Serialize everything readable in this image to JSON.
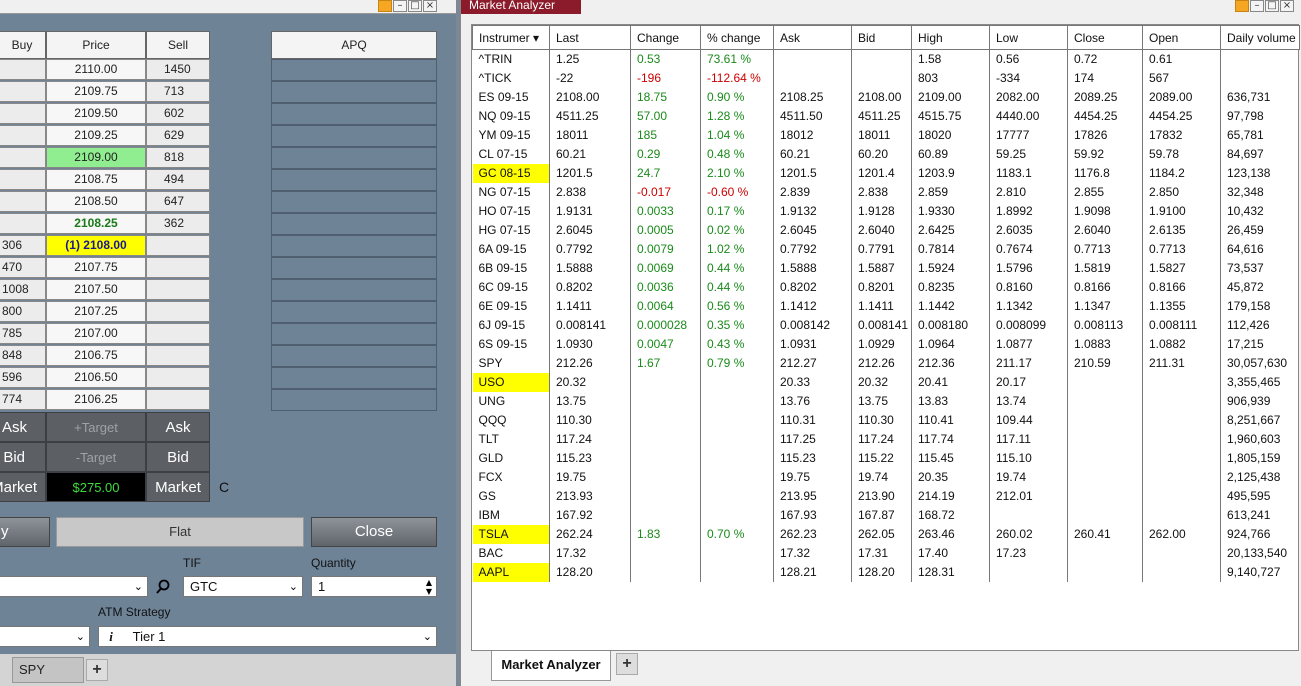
{
  "left_panel": {
    "headers": {
      "buy": "Buy",
      "price": "Price",
      "sell": "Sell",
      "apq": "APQ"
    },
    "ladder": [
      {
        "buy": "",
        "price": "2110.00",
        "sell": "1450"
      },
      {
        "buy": "",
        "price": "2109.75",
        "sell": "713"
      },
      {
        "buy": "",
        "price": "2109.50",
        "sell": "602"
      },
      {
        "buy": "",
        "price": "2109.25",
        "sell": "629"
      },
      {
        "buy": "",
        "price": "2109.00",
        "sell": "818"
      },
      {
        "buy": "",
        "price": "2108.75",
        "sell": "494"
      },
      {
        "buy": "",
        "price": "2108.50",
        "sell": "647"
      },
      {
        "buy": "",
        "price": "2108.25",
        "sell": "362"
      },
      {
        "buy": "306",
        "price": "(1) 2108.00",
        "sell": ""
      },
      {
        "buy": "470",
        "price": "2107.75",
        "sell": ""
      },
      {
        "buy": "1008",
        "price": "2107.50",
        "sell": ""
      },
      {
        "buy": "800",
        "price": "2107.25",
        "sell": ""
      },
      {
        "buy": "785",
        "price": "2107.00",
        "sell": ""
      },
      {
        "buy": "848",
        "price": "2106.75",
        "sell": ""
      },
      {
        "buy": "596",
        "price": "2106.50",
        "sell": ""
      },
      {
        "buy": "774",
        "price": "2106.25",
        "sell": ""
      }
    ],
    "buttons": {
      "buy_ask": "Ask",
      "target": "+Target",
      "sell_ask": "Ask",
      "buy_bid": "Bid",
      "stop": "-Target",
      "sell_bid": "Bid",
      "buy_market": "Market",
      "pnl": "$275.00",
      "sell_market": "Market",
      "c_label": "C",
      "rev": "y",
      "flat": "Flat",
      "close": "Close"
    },
    "order_fields": {
      "tif_label": "TIF",
      "tif_value": "GTC",
      "quantity_label": "Quantity",
      "quantity_value": "1",
      "atm_label": "ATM Strategy",
      "atm_value": "Tier 1"
    },
    "bottom_tab": "SPY"
  },
  "market_analyzer": {
    "window_title": "Market Analyzer",
    "tab_label": "Market Analyzer",
    "columns": [
      "Instrumer ▾",
      "Last",
      "Change",
      "% change",
      "Ask",
      "Bid",
      "High",
      "Low",
      "Close",
      "Open",
      "Daily volume"
    ],
    "rows": [
      {
        "inst": "^TRIN",
        "last": "1.25",
        "chg": "0.53",
        "pct": "73.61 %",
        "ask": "",
        "bid": "",
        "high": "1.58",
        "low": "0.56",
        "close": "0.72",
        "open": "0.61",
        "vol": "",
        "hl": false,
        "dir": "pos"
      },
      {
        "inst": "^TICK",
        "last": "-22",
        "chg": "-196",
        "pct": "-112.64 %",
        "ask": "",
        "bid": "",
        "high": "803",
        "low": "-334",
        "close": "174",
        "open": "567",
        "vol": "",
        "hl": false,
        "dir": "neg"
      },
      {
        "inst": "ES 09-15",
        "last": "2108.00",
        "chg": "18.75",
        "pct": "0.90 %",
        "ask": "2108.25",
        "bid": "2108.00",
        "high": "2109.00",
        "low": "2082.00",
        "close": "2089.25",
        "open": "2089.00",
        "vol": "636,731",
        "hl": false,
        "dir": "pos"
      },
      {
        "inst": "NQ 09-15",
        "last": "4511.25",
        "chg": "57.00",
        "pct": "1.28 %",
        "ask": "4511.50",
        "bid": "4511.25",
        "high": "4515.75",
        "low": "4440.00",
        "close": "4454.25",
        "open": "4454.25",
        "vol": "97,798",
        "hl": false,
        "dir": "pos"
      },
      {
        "inst": "YM 09-15",
        "last": "18011",
        "chg": "185",
        "pct": "1.04 %",
        "ask": "18012",
        "bid": "18011",
        "high": "18020",
        "low": "17777",
        "close": "17826",
        "open": "17832",
        "vol": "65,781",
        "hl": false,
        "dir": "pos"
      },
      {
        "inst": "CL 07-15",
        "last": "60.21",
        "chg": "0.29",
        "pct": "0.48 %",
        "ask": "60.21",
        "bid": "60.20",
        "high": "60.89",
        "low": "59.25",
        "close": "59.92",
        "open": "59.78",
        "vol": "84,697",
        "hl": false,
        "dir": "pos"
      },
      {
        "inst": "GC 08-15",
        "last": "1201.5",
        "chg": "24.7",
        "pct": "2.10 %",
        "ask": "1201.5",
        "bid": "1201.4",
        "high": "1203.9",
        "low": "1183.1",
        "close": "1176.8",
        "open": "1184.2",
        "vol": "123,138",
        "hl": true,
        "dir": "pos"
      },
      {
        "inst": "NG 07-15",
        "last": "2.838",
        "chg": "-0.017",
        "pct": "-0.60 %",
        "ask": "2.839",
        "bid": "2.838",
        "high": "2.859",
        "low": "2.810",
        "close": "2.855",
        "open": "2.850",
        "vol": "32,348",
        "hl": false,
        "dir": "neg"
      },
      {
        "inst": "HO 07-15",
        "last": "1.9131",
        "chg": "0.0033",
        "pct": "0.17 %",
        "ask": "1.9132",
        "bid": "1.9128",
        "high": "1.9330",
        "low": "1.8992",
        "close": "1.9098",
        "open": "1.9100",
        "vol": "10,432",
        "hl": false,
        "dir": "pos"
      },
      {
        "inst": "HG 07-15",
        "last": "2.6045",
        "chg": "0.0005",
        "pct": "0.02 %",
        "ask": "2.6045",
        "bid": "2.6040",
        "high": "2.6425",
        "low": "2.6035",
        "close": "2.6040",
        "open": "2.6135",
        "vol": "26,459",
        "hl": false,
        "dir": "pos"
      },
      {
        "inst": "6A 09-15",
        "last": "0.7792",
        "chg": "0.0079",
        "pct": "1.02 %",
        "ask": "0.7792",
        "bid": "0.7791",
        "high": "0.7814",
        "low": "0.7674",
        "close": "0.7713",
        "open": "0.7713",
        "vol": "64,616",
        "hl": false,
        "dir": "pos"
      },
      {
        "inst": "6B 09-15",
        "last": "1.5888",
        "chg": "0.0069",
        "pct": "0.44 %",
        "ask": "1.5888",
        "bid": "1.5887",
        "high": "1.5924",
        "low": "1.5796",
        "close": "1.5819",
        "open": "1.5827",
        "vol": "73,537",
        "hl": false,
        "dir": "pos"
      },
      {
        "inst": "6C 09-15",
        "last": "0.8202",
        "chg": "0.0036",
        "pct": "0.44 %",
        "ask": "0.8202",
        "bid": "0.8201",
        "high": "0.8235",
        "low": "0.8160",
        "close": "0.8166",
        "open": "0.8166",
        "vol": "45,872",
        "hl": false,
        "dir": "pos"
      },
      {
        "inst": "6E 09-15",
        "last": "1.1411",
        "chg": "0.0064",
        "pct": "0.56 %",
        "ask": "1.1412",
        "bid": "1.1411",
        "high": "1.1442",
        "low": "1.1342",
        "close": "1.1347",
        "open": "1.1355",
        "vol": "179,158",
        "hl": false,
        "dir": "pos"
      },
      {
        "inst": "6J 09-15",
        "last": "0.008141",
        "chg": "0.000028",
        "pct": "0.35 %",
        "ask": "0.008142",
        "bid": "0.008141",
        "high": "0.008180",
        "low": "0.008099",
        "close": "0.008113",
        "open": "0.008111",
        "vol": "112,426",
        "hl": false,
        "dir": "pos"
      },
      {
        "inst": "6S 09-15",
        "last": "1.0930",
        "chg": "0.0047",
        "pct": "0.43 %",
        "ask": "1.0931",
        "bid": "1.0929",
        "high": "1.0964",
        "low": "1.0877",
        "close": "1.0883",
        "open": "1.0882",
        "vol": "17,215",
        "hl": false,
        "dir": "pos"
      },
      {
        "inst": "SPY",
        "last": "212.26",
        "chg": "1.67",
        "pct": "0.79 %",
        "ask": "212.27",
        "bid": "212.26",
        "high": "212.36",
        "low": "211.17",
        "close": "210.59",
        "open": "211.31",
        "vol": "30,057,630",
        "hl": false,
        "dir": "pos"
      },
      {
        "inst": "USO",
        "last": "20.32",
        "chg": "",
        "pct": "",
        "ask": "20.33",
        "bid": "20.32",
        "high": "20.41",
        "low": "20.17",
        "close": "",
        "open": "",
        "vol": "3,355,465",
        "hl": true,
        "dir": "pos"
      },
      {
        "inst": "UNG",
        "last": "13.75",
        "chg": "",
        "pct": "",
        "ask": "13.76",
        "bid": "13.75",
        "high": "13.83",
        "low": "13.74",
        "close": "",
        "open": "",
        "vol": "906,939",
        "hl": false,
        "dir": "pos"
      },
      {
        "inst": "QQQ",
        "last": "110.30",
        "chg": "",
        "pct": "",
        "ask": "110.31",
        "bid": "110.30",
        "high": "110.41",
        "low": "109.44",
        "close": "",
        "open": "",
        "vol": "8,251,667",
        "hl": false,
        "dir": "pos"
      },
      {
        "inst": "TLT",
        "last": "117.24",
        "chg": "",
        "pct": "",
        "ask": "117.25",
        "bid": "117.24",
        "high": "117.74",
        "low": "117.11",
        "close": "",
        "open": "",
        "vol": "1,960,603",
        "hl": false,
        "dir": "pos"
      },
      {
        "inst": "GLD",
        "last": "115.23",
        "chg": "",
        "pct": "",
        "ask": "115.23",
        "bid": "115.22",
        "high": "115.45",
        "low": "115.10",
        "close": "",
        "open": "",
        "vol": "1,805,159",
        "hl": false,
        "dir": "pos"
      },
      {
        "inst": "FCX",
        "last": "19.75",
        "chg": "",
        "pct": "",
        "ask": "19.75",
        "bid": "19.74",
        "high": "20.35",
        "low": "19.74",
        "close": "",
        "open": "",
        "vol": "2,125,438",
        "hl": false,
        "dir": "pos"
      },
      {
        "inst": "GS",
        "last": "213.93",
        "chg": "",
        "pct": "",
        "ask": "213.95",
        "bid": "213.90",
        "high": "214.19",
        "low": "212.01",
        "close": "",
        "open": "",
        "vol": "495,595",
        "hl": false,
        "dir": "pos"
      },
      {
        "inst": "IBM",
        "last": "167.92",
        "chg": "",
        "pct": "",
        "ask": "167.93",
        "bid": "167.87",
        "high": "168.72",
        "low": "",
        "close": "",
        "open": "",
        "vol": "613,241",
        "hl": false,
        "dir": "pos"
      },
      {
        "inst": "TSLA",
        "last": "262.24",
        "chg": "1.83",
        "pct": "0.70 %",
        "ask": "262.23",
        "bid": "262.05",
        "high": "263.46",
        "low": "260.02",
        "close": "260.41",
        "open": "262.00",
        "vol": "924,766",
        "hl": true,
        "dir": "pos"
      },
      {
        "inst": "BAC",
        "last": "17.32",
        "chg": "",
        "pct": "",
        "ask": "17.32",
        "bid": "17.31",
        "high": "17.40",
        "low": "17.23",
        "close": "",
        "open": "",
        "vol": "20,133,540",
        "hl": false,
        "dir": "pos"
      },
      {
        "inst": "AAPL",
        "last": "128.20",
        "chg": "",
        "pct": "",
        "ask": "128.21",
        "bid": "128.20",
        "high": "128.31",
        "low": "",
        "close": "",
        "open": "",
        "vol": "9,140,727",
        "hl": true,
        "dir": "pos"
      }
    ]
  },
  "colors": {
    "positive": "#1a8a1a",
    "negative": "#cc0000",
    "highlight": "#ffff00",
    "title_tab": "#8b1a2a"
  },
  "icons": {
    "search": "search-icon",
    "info": "info-icon",
    "dropdown": "chevron-down-icon",
    "add_tab": "plus-icon"
  }
}
